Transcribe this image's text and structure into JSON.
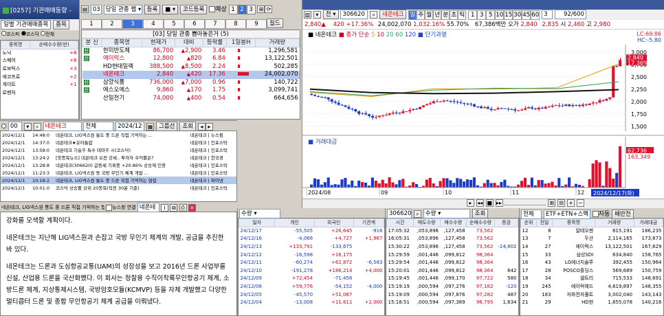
{
  "left_strip": {
    "title": "[0257] 기관매매동향 -",
    "tab_main": "일별 기관매매종목",
    "tab_side": "종목",
    "radio_a": "코스피",
    "radio_b": "코스닥",
    "radio_c": "전체",
    "header": [
      "종목명",
      "순매수수량(만)"
    ],
    "rows": [
      {
        "name": "노닉",
        "v": "+8"
      },
      {
        "name": "스퀘어",
        "v": "+6"
      },
      {
        "name": "로보틱스",
        "v": "+3"
      },
      {
        "name": "에코프로",
        "v": "+2"
      },
      {
        "name": "게이트",
        "v": "+1"
      },
      {
        "name": "로벤처",
        "v": ""
      }
    ]
  },
  "left_mid": {
    "icon_top": "03",
    "title": "당일 관종 쨉",
    "register": "등록",
    "code_reg": "코드등록",
    "forecast": "예상",
    "page_btns": [
      "1",
      "2",
      "3"
    ],
    "num_tabs": [
      "1",
      "2",
      "3",
      "4",
      "5",
      "6",
      "7",
      "8",
      "9"
    ],
    "filter": "필드",
    "list_title": "[03] 당일 관종 뽑아놓은거 (5)",
    "headers": [
      "분 신",
      "종목명",
      "현재가",
      "대비",
      "등락률",
      "1일봉H",
      "거래량"
    ],
    "rows": [
      {
        "flag": "신",
        "name": "한미반도체",
        "price": "86,700",
        "dir": "▲",
        "chg": "2,900",
        "rate": "3.46",
        "vol": "1,296,581",
        "cls": "up"
      },
      {
        "flag": "신",
        "name": "에이럭스",
        "price": "12,800",
        "dir": "▲",
        "chg": "820",
        "rate": "6.84",
        "vol": "13,122,501",
        "cls": "up"
      },
      {
        "flag": "",
        "name": "HD현대일렉",
        "price": "388,500",
        "dir": "▲",
        "chg": "8,500",
        "rate": "2.24",
        "vol": "502,285",
        "cls": "up"
      },
      {
        "flag": "",
        "name": "네온테크",
        "price": "2,840",
        "dir": "▲",
        "chg": "420",
        "rate": "17.36",
        "vol": "24,002,070",
        "cls": "up"
      },
      {
        "flag": "신",
        "name": "삼양식품",
        "price": "736,000",
        "dir": "▲",
        "chg": "7,000",
        "rate": "0.96",
        "vol": "140,722",
        "cls": "up"
      },
      {
        "flag": "신",
        "name": "에스오에스",
        "price": "9,860",
        "dir": "▲",
        "chg": "170",
        "rate": "1.75",
        "vol": "3,099,741",
        "cls": "up"
      },
      {
        "flag": "",
        "name": "산일전기",
        "price": "74,000",
        "dir": "▲",
        "chg": "400",
        "rate": "0.54",
        "vol": "664,656",
        "cls": "up"
      }
    ]
  },
  "news": {
    "period": "00",
    "code_box": "네온테크",
    "category": "전체",
    "date": "2024/12",
    "refresh": "그룹선",
    "query": "조회",
    "items": [
      {
        "date": "2024/12/1",
        "time": "14:48:0",
        "title": "네온테크, LIG넥스원 통도 중 드론 직접 기억하는 ...",
        "src": "네온테크 | 뉴스핌"
      },
      {
        "date": "2024/12/1",
        "time": "14:37:0",
        "title": "네온테크★유아통합",
        "src": "네온테크 | 인포스탁"
      },
      {
        "date": "2024/12/1",
        "time": "13:58:0",
        "title": "네온테크 기술주 특수 테마주 시(코스닥)",
        "src": "네온테크 | 인포스탁"
      },
      {
        "date": "2024/12/1",
        "time": "13:24:2",
        "title": "[핫종목뉴스] 네온테크 오전 강세.. 투자자 수익률은?",
        "src": "네온테크 | 한국경"
      },
      {
        "date": "2024/12/1",
        "time": "13:28:8",
        "title": "네온테크(306620) 급등세 기록중 +20.86% 상승재 인용",
        "src": "네온테크 | 인포스탁"
      },
      {
        "date": "2024/12/1",
        "time": "11:23:3",
        "title": "네온테크, LIG넥스원 등 국방 무인기 체계 개발 ...",
        "src": "네온테크 | 인포스탁"
      },
      {
        "date": "2024/12/1",
        "time": "10:18:2",
        "title": "네온테크, LIG넥스원 통도 중 드론 직접 기억하는 협업",
        "src": "네온테크 | 파이낸"
      },
      {
        "date": "2024/12/1",
        "time": "10:01:0",
        "title": "코스닥 상승률 상위 20종목(직전 30분 기준)",
        "src": "네온테크 | 인포스탁"
      }
    ],
    "foot_label": "네온테크, LIG넥스원 통도 중 드론 직접 기억하는 협업",
    "foot_check": "뉴스창 연결",
    "foot_box": "네온테",
    "body": [
      "강화를 모색할 계획이다.",
      "네온테크는 지난해 LIG넥스원과 손잡고 국방 무인기 체계의 개발, 공급을 추진한 바 있다.",
      "네온테크는 드론과 도심항공교통(UAM)의 성장성을 보고 2016년 드론 사업부를 신설, 산업용 드론을 국산화했다. 이 회사는 정찰용 수직이착륙무인항공기 체계, 소방드론 체계, 지상통제시스템, 국방암호모듈(KCMVP) 등을 자체 개발했고 다양한 멀티콥터 드론 및 종합 무인항공기 체계 공급을 이뤄냈다."
    ]
  },
  "chart": {
    "code": "306620",
    "name": "네온테크",
    "modes": [
      "일",
      "주",
      "월",
      "년",
      "분",
      "초",
      "틱"
    ],
    "intervals": [
      "1",
      "3",
      "5",
      "10",
      "15",
      "30",
      "45",
      "60"
    ],
    "period_box": "3",
    "count": "92/600",
    "price_line": {
      "price": "2,840",
      "dir": "▲",
      "chg": "420",
      "rate": "+17.36%",
      "vol": "24,002,070",
      "volrate": "1,032.16%",
      "ratio": "55.70%",
      "amount": "67,386백만",
      "open_label": "오가",
      "open": "2,840",
      "high": "2,835",
      "low_label": "시",
      "low": "2,460",
      "close_label": "고",
      "close": "2,980"
    },
    "legend": {
      "name": "네온테크",
      "ma_label": "종가 단순",
      "ma": [
        "5",
        "10",
        "20",
        "60",
        "120"
      ],
      "trend": "단기과열"
    },
    "lc": "LC:69.86",
    "hc": "HC:-5.80",
    "current": "2,840",
    "current_rate": "17.36%",
    "y_ticks": [
      "3,000",
      "2,750",
      "2,500",
      "2,250",
      "2,000",
      "1,750",
      "1,500"
    ],
    "vol_title": "거래대금",
    "vol_current": "62,736",
    "vol_tag": "163,349",
    "x_labels": [
      "2024/08",
      "09",
      "10",
      "11",
      "12"
    ],
    "date_tag": "2024/12/17(화)",
    "accent_red": "#e0102c",
    "accent_blue": "#1c3cc8"
  },
  "chart_data": {
    "type": "line",
    "x": [
      "2024/08",
      "09",
      "10",
      "11",
      "12",
      "2024/12/17"
    ],
    "series": [
      {
        "name": "5",
        "values": [
          2180,
          2100,
          2260,
          2250,
          2280,
          2760
        ]
      },
      {
        "name": "20",
        "values": [
          2200,
          2120,
          2230,
          2270,
          2260,
          2400
        ]
      },
      {
        "name": "120",
        "values": [
          2250,
          2180,
          2160,
          2170,
          2200,
          2240
        ]
      }
    ],
    "ylim": [
      1400,
      3150
    ]
  },
  "bottom_mid": {
    "label": "수량",
    "cols": [
      "일자",
      "개인",
      "외국인",
      "기관계"
    ],
    "rows": [
      [
        "24/12/17",
        "-55,505",
        "+26,645",
        "-916"
      ],
      [
        "24/12/16",
        "-4,066",
        "+4,727",
        "+1,967"
      ],
      [
        "24/12/13",
        "+133,791",
        "-133,675",
        ""
      ],
      [
        "24/12/12",
        "-16,598",
        "+16,175",
        ""
      ],
      [
        "24/12/11",
        "-60,274",
        "+62,872",
        "-6,583"
      ],
      [
        "24/12/10",
        "-191,278",
        "+186,214",
        "+4,000"
      ],
      [
        "24/12/09",
        "+72,454",
        "-71,458",
        ""
      ],
      [
        "24/12/06",
        "+59,776",
        "-54,152",
        "-4,000"
      ],
      [
        "24/12/05",
        "-45,570",
        "+51,087",
        ""
      ],
      [
        "24/12/04",
        "-13,008",
        "+11,611",
        "+2,000"
      ]
    ]
  },
  "bottom_exec": {
    "code": "306620",
    "query": "조회",
    "cols": [
      "시간",
      "매도수량",
      "매수수량",
      "순매수수량",
      "증감"
    ],
    "rows": [
      [
        "17:05:32",
        ",053,896",
        ",127,458",
        "73,562",
        ""
      ],
      [
        "16:05:31",
        ",053,896",
        ",127,458",
        "73,562",
        ""
      ],
      [
        "15:30:22",
        ",053,896",
        ",127,458",
        "73,562",
        "-24,802"
      ],
      [
        "15:29:59",
        ",001,446",
        ",099,812",
        "98,364",
        ""
      ],
      [
        "15:29:54",
        ",001,446",
        ",099,812",
        "98,364",
        ""
      ],
      [
        "15:20:01",
        ",001,446",
        ",099,812",
        "98,364",
        "642"
      ],
      [
        "15:19:45",
        ",001,446",
        ",099,170",
        "97,722",
        "580"
      ],
      [
        "15:19:19",
        ",000,594",
        ",097,276",
        "97,182",
        "-120"
      ],
      [
        "15:19:09",
        ",000,594",
        ",097,876",
        "97,282",
        "487"
      ],
      [
        "15:18:51",
        ",000,594",
        ",097,389",
        "96,795",
        "1,634"
      ]
    ]
  },
  "bottom_rank": {
    "label": "전체",
    "etf": "ETF+ETN+스팩",
    "auto": "자동",
    "search": "배반전",
    "cols": [
      "순위",
      "전일",
      "종목명",
      "거래량",
      "거래대금"
    ],
    "rows": [
      [
        "12",
        "8",
        "알테오젠",
        "615,191",
        "186,235"
      ],
      [
        "13",
        "7",
        "두산",
        "2,114,165",
        "173,673"
      ],
      [
        "14",
        "27",
        "에이럭스",
        "13,122,501",
        "167,629"
      ],
      [
        "15",
        "33",
        "삼성SDI",
        "634,840",
        "158,765"
      ],
      [
        "16",
        "43",
        "LG에너지솔루",
        "392,455",
        "150,964"
      ],
      [
        "17",
        "28",
        "POSCO홀딩스",
        "569,689",
        "150,759"
      ],
      [
        "18",
        "34",
        "셀트리",
        "715,533",
        "148,691"
      ],
      [
        "19",
        "245",
        "에이럭헤드",
        "4,619,897",
        "148,355"
      ],
      [
        "20",
        "183",
        "자화전자풀트",
        "3,002,040",
        "143,143"
      ],
      [
        "21",
        "29",
        "HD현",
        "1,655,078",
        "140,216"
      ]
    ]
  }
}
